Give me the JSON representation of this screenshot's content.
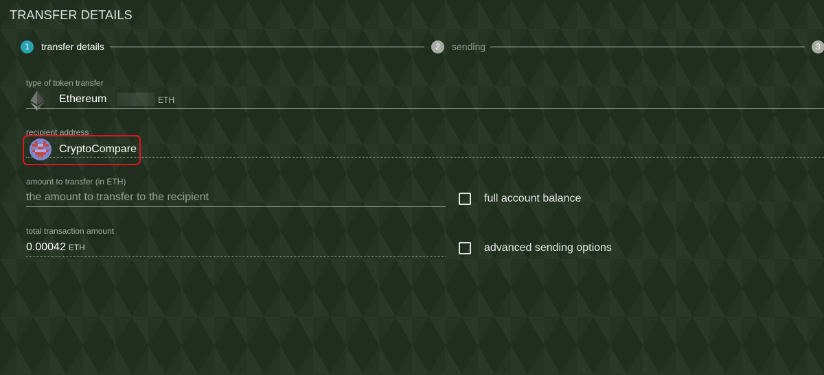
{
  "page": {
    "title": "TRANSFER DETAILS"
  },
  "stepper": {
    "steps": [
      {
        "number": "1",
        "label": "transfer details",
        "active": true
      },
      {
        "number": "2",
        "label": "sending",
        "active": false
      },
      {
        "number": "3",
        "label": "",
        "active": false
      }
    ],
    "active_color": "#2aa3b0",
    "inactive_color": "#a8aea6"
  },
  "token_transfer": {
    "label": "type of token transfer",
    "token_name": "Ethereum",
    "token_unit": "ETH",
    "icon": "ethereum-icon"
  },
  "recipient": {
    "label": "recipient address",
    "name": "CryptoCompare",
    "icon": "identicon-avatar",
    "highlight_color": "#e0141e"
  },
  "amount": {
    "label": "amount to transfer (in ETH)",
    "placeholder": "the amount to transfer to the recipient",
    "value": ""
  },
  "full_balance": {
    "label": "full account balance",
    "checked": false
  },
  "total": {
    "label": "total transaction amount",
    "value": "0.00042",
    "unit": "ETH"
  },
  "advanced": {
    "label": "advanced sending options",
    "checked": false
  }
}
